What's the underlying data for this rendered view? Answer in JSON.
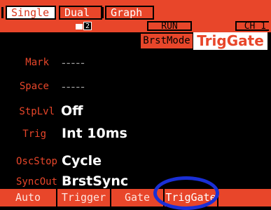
{
  "tabs": [
    {
      "label": "Single",
      "active": true
    },
    {
      "label": "Dual",
      "active": false
    },
    {
      "label": "Graph",
      "active": false
    }
  ],
  "page_indicator": "2",
  "status": {
    "run": "RUN",
    "channel": "CH 1",
    "mode_badge": "BrstMode",
    "trigger_type": "TrigGate"
  },
  "params": {
    "mark": {
      "label": "Mark",
      "value": "-----"
    },
    "space": {
      "label": "Space",
      "value": "-----"
    },
    "stop_level": {
      "label": "StpLvl",
      "value": "Off"
    },
    "trig": {
      "label": "Trig",
      "value": "Int 10ms"
    },
    "osc_stop": {
      "label": "OscStop",
      "value": "Cycle"
    },
    "sync_out": {
      "label": "SyncOut",
      "value": "BrstSync"
    }
  },
  "softkeys": [
    "Auto",
    "Trigger",
    "Gate",
    "TrigGate",
    ""
  ],
  "colors": {
    "accent": "#e8462a",
    "background": "#000000",
    "highlight_ring": "#1a2fd6"
  }
}
